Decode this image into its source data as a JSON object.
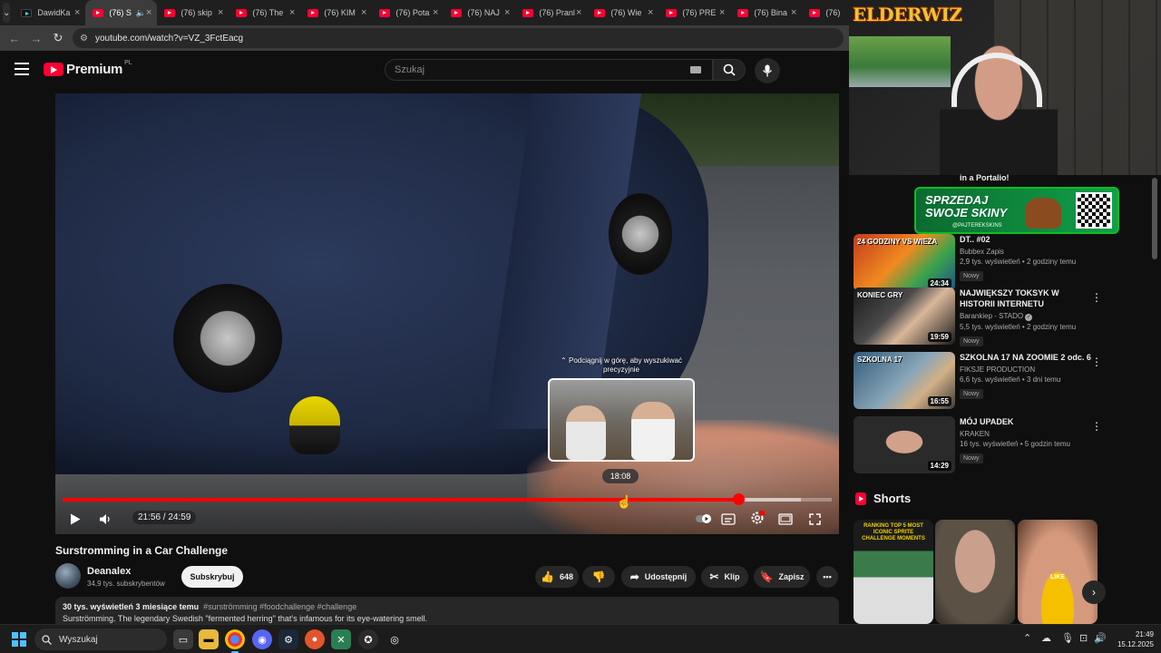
{
  "browser": {
    "tabs": [
      {
        "title": "DawidKa",
        "type": "tiktok",
        "active": false
      },
      {
        "title": "(76) S",
        "type": "youtube",
        "active": true,
        "audio": true
      },
      {
        "title": "(76) skip",
        "type": "youtube",
        "active": false
      },
      {
        "title": "(76) The",
        "type": "youtube",
        "active": false
      },
      {
        "title": "(76) KIM",
        "type": "youtube",
        "active": false
      },
      {
        "title": "(76) Pota",
        "type": "youtube",
        "active": false
      },
      {
        "title": "(76) NAJ",
        "type": "youtube",
        "active": false
      },
      {
        "title": "(76) Pranl",
        "type": "youtube",
        "active": false
      },
      {
        "title": "(76) Wie",
        "type": "youtube",
        "active": false
      },
      {
        "title": "(76) PRE",
        "type": "youtube",
        "active": false
      },
      {
        "title": "(76) Bina",
        "type": "youtube",
        "active": false
      },
      {
        "title": "(76)",
        "type": "youtube",
        "active": false
      }
    ],
    "url": "youtube.com/watch?v=VZ_3FctEacg"
  },
  "youtube": {
    "logo_text": "Premium",
    "logo_region": "PL",
    "search_placeholder": "Szukaj"
  },
  "player": {
    "preview_hint": "Podciągnij w górę, aby wyszukiwać precyzyjnie",
    "hover_time": "18:08",
    "timecode": "21:56 / 24:59",
    "progress_played": 0.878,
    "progress_buffered": 0.96,
    "hover_position": 0.727
  },
  "video": {
    "title": "Surstromming in a Car Challenge",
    "channel": "Deanalex",
    "subscribers": "34,9 tys. subskrybentów",
    "subscribe_label": "Subskrybuj",
    "likes": "648",
    "share_label": "Udostępnij",
    "clip_label": "Klip",
    "save_label": "Zapisz",
    "description": {
      "meta": "30 tys. wyświetleń  3 miesiące temu",
      "tags": "#surströmming #foodchallenge #challenge",
      "text": "Surströmming. The legendary Swedish \"fermented herring\" that's infamous for its eye-watering smell."
    }
  },
  "stream_overlay": {
    "brand": "ELDERWIZ"
  },
  "sidebar": {
    "partial_title": "in a Portalio!",
    "promo": {
      "title": "SPRZEDAJ SWOJE SKINY",
      "sub": "@PAJTEREKSKINS"
    },
    "videos": [
      {
        "title": "DT.. #02",
        "channel": "Bubbex Zapis",
        "meta": "2,9 tys. wyświetleń • 2 godziny temu",
        "badge": "Nowy",
        "duration": "24:34",
        "verified": false,
        "thumb_label": "24 GODZINY VS WIEŻA"
      },
      {
        "title": "NAJWIĘKSZY TOKSYK W HISTORII INTERNETU",
        "channel": "Barankiep - STADO",
        "meta": "5,5 tys. wyświetleń • 2 godziny temu",
        "badge": "Nowy",
        "duration": "19:59",
        "verified": true,
        "thumb_label": "KONIEC GRY"
      },
      {
        "title": "SZKOLNA 17 NA ZOOMIE 2 odc. 6",
        "channel": "FIKSJE PRODUCTION",
        "meta": "6,6 tys. wyświetleń • 3 dni temu",
        "badge": "Nowy",
        "duration": "16:55",
        "verified": false,
        "thumb_label": "SZKOLNA 17"
      },
      {
        "title": "MÓJ UPADEK",
        "channel": "KRAKEN",
        "meta": "16 tys. wyświetleń • 5 godzin temu",
        "badge": "Nowy",
        "duration": "14:29",
        "verified": false,
        "thumb_label": ""
      }
    ],
    "shorts_heading": "Shorts",
    "shorts": [
      {
        "label": "RANKING TOP 5 MOST ICONIC SPRITE CHALLENGE MOMENTS"
      },
      {
        "label": ""
      },
      {
        "label": "LIKE"
      }
    ]
  },
  "taskbar": {
    "search_label": "Wyszukaj",
    "time": "21:49",
    "date": "15.12.2025"
  },
  "colors": {
    "accent": "#ff0033",
    "progress": "#ff0000",
    "background": "#0f0f0f",
    "windows_accent": "#4cc2ff"
  }
}
